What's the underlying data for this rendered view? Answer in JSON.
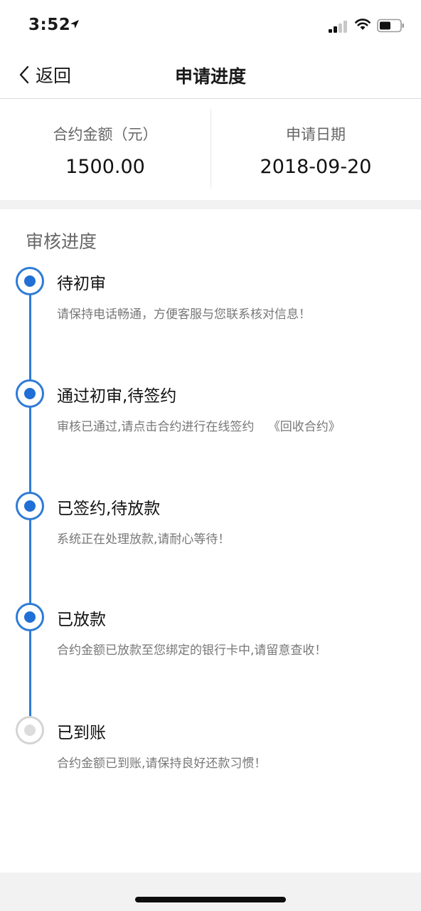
{
  "status_bar": {
    "time": "3:52"
  },
  "nav": {
    "back_label": "返回",
    "title": "申请进度"
  },
  "summary": {
    "amount_label": "合约金额（元）",
    "amount_value": "1500.00",
    "date_label": "申请日期",
    "date_value": "2018-09-20"
  },
  "progress": {
    "title": "审核进度",
    "steps": [
      {
        "title": "待初审",
        "desc": "请保持电话畅通，方便客服与您联系核对信息！",
        "active": true
      },
      {
        "title": "通过初审,待签约",
        "desc": "审核已通过,请点击合约进行在线签约",
        "link": "《回收合约》",
        "active": true
      },
      {
        "title": "已签约,待放款",
        "desc": "系统正在处理放款,请耐心等待！",
        "active": true
      },
      {
        "title": "已放款",
        "desc": "合约金额已放款至您绑定的银行卡中,请留意查收！",
        "active": true
      },
      {
        "title": "已到账",
        "desc": "合约金额已到账,请保持良好还款习惯！",
        "active": false
      }
    ]
  },
  "colors": {
    "accent": "#2f7bd6",
    "inactive": "#dcdcdc",
    "band": "#f2f2f2"
  }
}
